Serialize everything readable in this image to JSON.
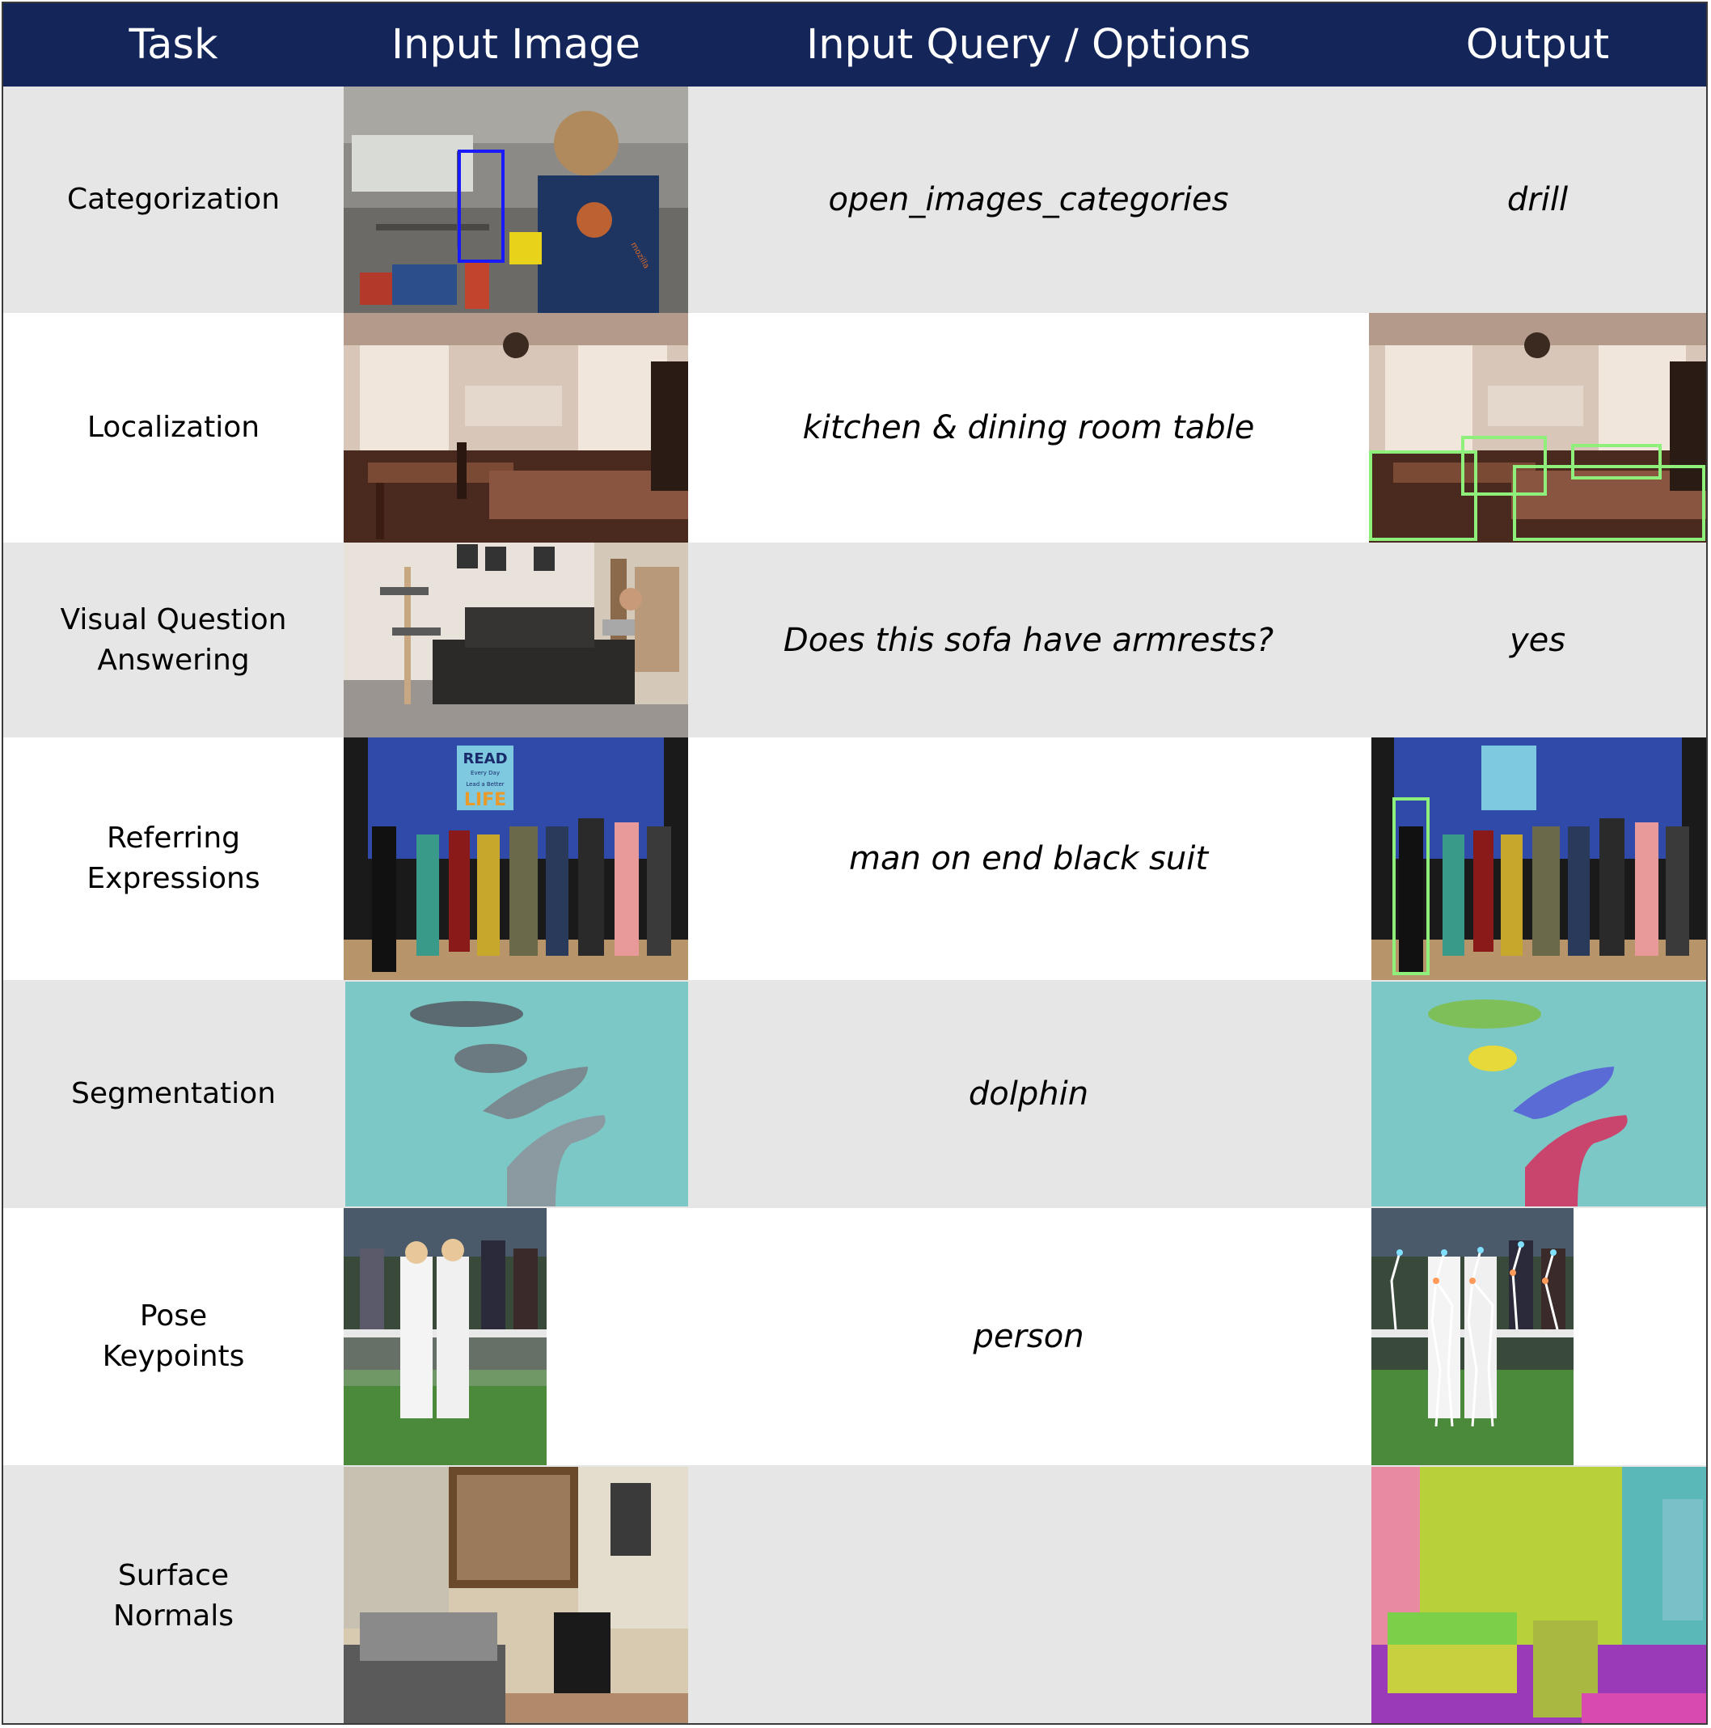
{
  "header": {
    "task": "Task",
    "input_image": "Input Image",
    "query": "Input Query / Options",
    "output": "Output"
  },
  "rows": [
    {
      "task": "Categorization",
      "query": "open_images_categories",
      "output": "drill"
    },
    {
      "task": "Localization",
      "query": "kitchen & dining room table",
      "output": ""
    },
    {
      "task": "Visual Question\nAnswering",
      "query": "Does this sofa have armrests?",
      "output": "yes"
    },
    {
      "task": "Referring\nExpressions",
      "query": "man on end black suit",
      "output": ""
    },
    {
      "task": "Segmentation",
      "query": "dolphin",
      "output": ""
    },
    {
      "task": "Pose\nKeypoints",
      "query": "person",
      "output": ""
    },
    {
      "task": "Surface\nNormals",
      "query": "",
      "output": ""
    }
  ],
  "images": {
    "poster_text": {
      "line1": "READ",
      "line2": "Every Day",
      "line3": "Lead a Better",
      "line4": "LIFE"
    },
    "shirt_text": "mozilla"
  },
  "colors": {
    "header_bg": "#142559",
    "shaded_row": "#e6e6e6",
    "box_blue": "#1a1aff",
    "box_green": "#8ef07a",
    "seg_green": "#7fbf5a",
    "seg_yellow": "#e8d93a",
    "seg_blue": "#5a6bd6",
    "seg_red": "#c9456e"
  }
}
